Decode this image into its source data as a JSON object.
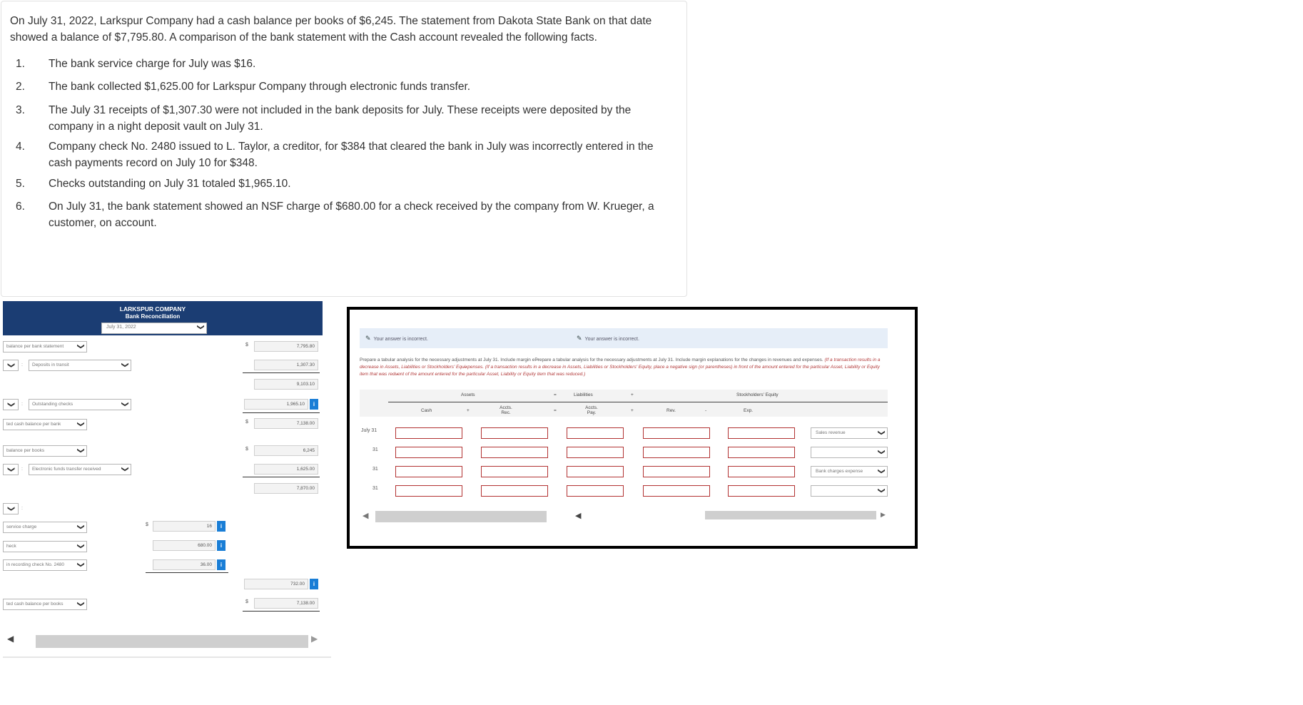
{
  "problem": {
    "intro": "On July 31, 2022, Larkspur Company had a cash balance per books of $6,245. The statement from Dakota State Bank on that date showed a balance of $7,795.80. A comparison of the bank statement with the Cash account revealed the following facts.",
    "facts": [
      {
        "num": "1.",
        "text": "The bank service charge for July was $16."
      },
      {
        "num": "2.",
        "text": "The bank collected $1,625.00 for Larkspur Company through electronic funds transfer."
      },
      {
        "num": "3.",
        "text": "The July 31 receipts of $1,307.30 were not included in the bank deposits for July. These receipts were deposited by the company in a night deposit vault on July 31."
      },
      {
        "num": "4.",
        "text": "Company check No. 2480 issued to L. Taylor, a creditor, for $384 that cleared the bank in July was incorrectly entered in the cash payments record on July 10 for $348."
      },
      {
        "num": "5.",
        "text": "Checks outstanding on July 31 totaled $1,965.10."
      },
      {
        "num": "6.",
        "text": "On July 31, the bank statement showed an NSF charge of $680.00 for a check received by the company from W. Krueger, a customer, on account."
      }
    ]
  },
  "recon": {
    "company": "LARKSPUR COMPANY",
    "title": "Bank Reconciliation",
    "date": "July 31, 2022",
    "dollar": "$",
    "chevron": "❯",
    "info": "i",
    "colon": ":",
    "rows": {
      "bank_balance_label": "balance per bank statement",
      "bank_balance_value": "7,795.80",
      "deposits_label": "Deposits in transit",
      "deposits_value": "1,307.30",
      "subtotal_value": "9,103.10",
      "outstanding_label": "Outstanding checks",
      "outstanding_value": "1,965.10",
      "adj_bank_label": "ted cash balance per bank",
      "adj_bank_value": "7,138.00",
      "books_label": "balance per books",
      "books_value": "6,245",
      "eft_label": "Electronic funds transfer received",
      "eft_value": "1,625.00",
      "books_subtotal_value": "7,870.00",
      "service_label": "service charge",
      "service_value": "16",
      "check_label": "heck",
      "check_value": "680.00",
      "error_label": "in recording check No. 2480",
      "error_value": "36.00",
      "deductions_value": "732.00",
      "adj_books_label": "ted cash balance per books",
      "adj_books_value": "7,138.00"
    }
  },
  "tabular": {
    "feedback1": "Your answer is incorrect.",
    "feedback2": "Your answer is incorrect.",
    "instructions_plain": "Prepare a tabular analysis for the necessary adjustments at July 31. Include margin eP̶repare a tabular analysis for the necessary adjustments at July 31. Include margin explanations for the changes in revenues and expenses. ",
    "instructions_red": "(If a transaction results in a decrease in Assets, Liabilities or Stockholders' Equi̶xpenses. (If a transaction results in a decrease in Assets, Liabilities or Stockholders' Equity, place a negative sign (or parentheses) in front of the amount entered for the particular Asset, Liability or Equity item that was redu̶ont of the amount entered for the particular Asset, Liability or Equity item that was reduced.)",
    "head": {
      "assets": "Assets",
      "eq": "=",
      "liabilities": "Liabilities",
      "plus": "+",
      "equity": "Stockholders' Equity",
      "cash": "Cash",
      "plus2": "+",
      "accts_rec": "Accts. Rec.",
      "eq2": "=",
      "accts_pay": "Accts. Pay.",
      "plus3": "+",
      "rev": "Rev.",
      "minus": "-",
      "exp": "Exp."
    },
    "rows": [
      {
        "label": "July 31",
        "explanation": "Sales revenue"
      },
      {
        "label": "31",
        "explanation": ""
      },
      {
        "label": "31",
        "explanation": "Bank charges expense"
      },
      {
        "label": "31",
        "explanation": ""
      }
    ]
  }
}
